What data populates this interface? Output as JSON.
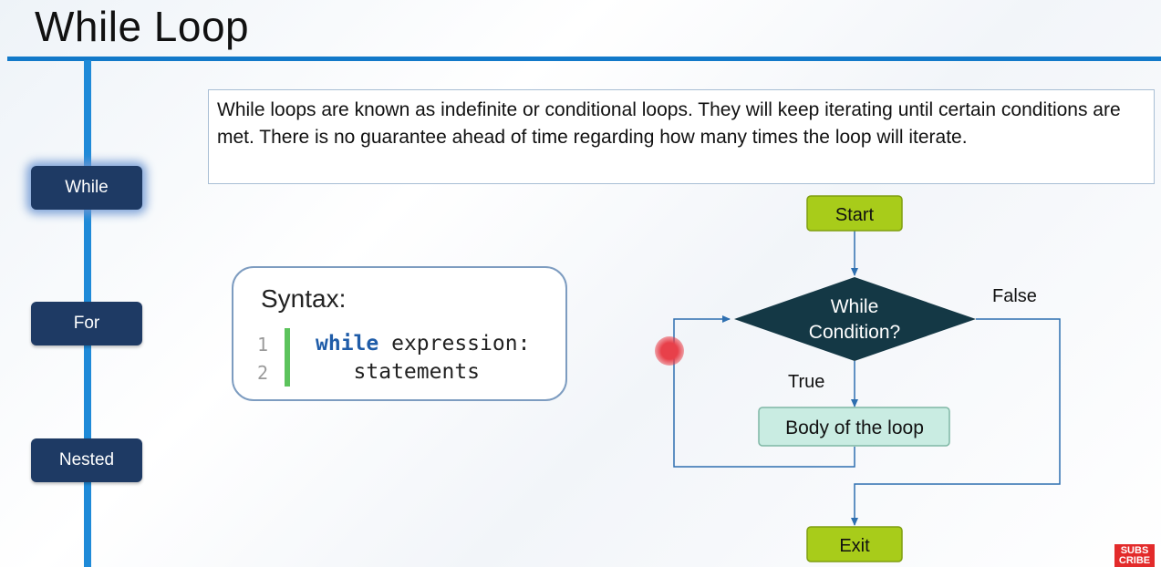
{
  "title": "While Loop",
  "nav": {
    "items": [
      {
        "label": "While",
        "active": true
      },
      {
        "label": "For",
        "active": false
      },
      {
        "label": "Nested",
        "active": false
      }
    ]
  },
  "description": "While loops are known as indefinite or conditional loops. They will keep iterating until certain conditions are met. There is no guarantee ahead of time regarding how many times the loop will iterate.",
  "syntax": {
    "heading": "Syntax:",
    "lines": [
      {
        "num": "1",
        "keyword": "while",
        "rest": " expression:"
      },
      {
        "num": "2",
        "keyword": "",
        "rest": "   statements"
      }
    ]
  },
  "flowchart": {
    "start": "Start",
    "condition_line1": "While",
    "condition_line2": "Condition?",
    "false_label": "False",
    "true_label": "True",
    "body": "Body of the loop",
    "exit": "Exit"
  },
  "badge": {
    "line1": "SUBS",
    "line2": "CRIBE"
  },
  "colors": {
    "accent_blue": "#1279c9",
    "nav_button": "#1e3a64",
    "terminal_green": "#a8cc1a",
    "decision_dark": "#143845",
    "body_box": "#c9ece2"
  }
}
